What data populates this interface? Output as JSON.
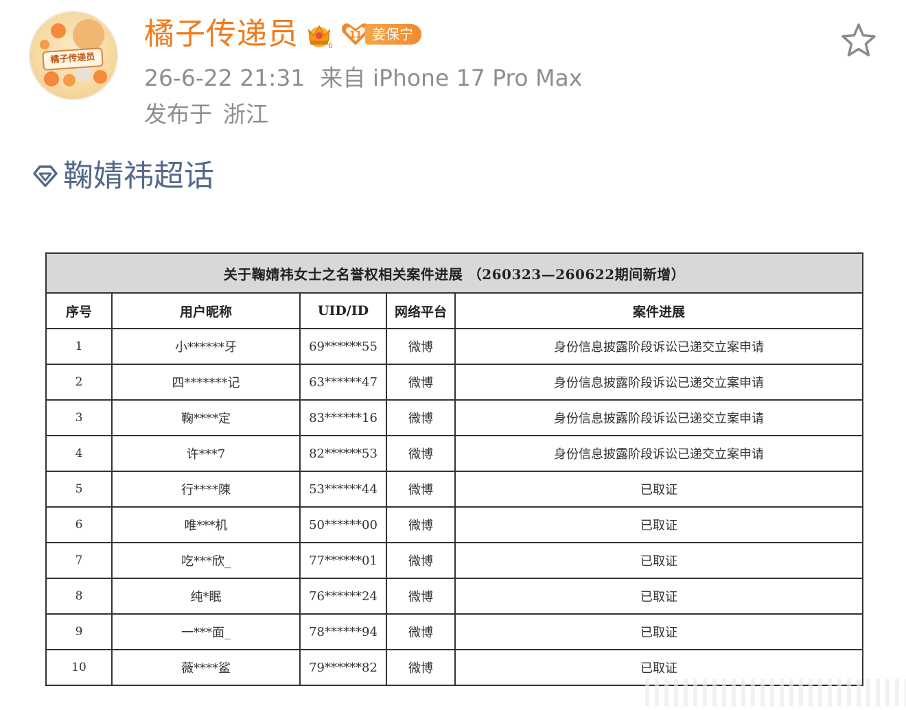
{
  "post": {
    "username": "橘子传递员",
    "avatar_text": "橘子传递员",
    "fan_badge": {
      "level": "11",
      "name": "姜保宁"
    },
    "timestamp": "26-6-22 21:31",
    "source": "来自 iPhone 17 Pro Max",
    "location_prefix": "发布于",
    "location": "浙江",
    "topic": "鞠婧祎超话",
    "icons": {
      "crown": "crown-vip-badge-icon",
      "fan": "heart-fan-badge-icon",
      "favorite": "star-outline-icon",
      "topic": "super-topic-diamond-icon"
    },
    "colors": {
      "username": "#f27a18",
      "meta": "#8e8e8e",
      "topic": "#55698a",
      "badge": "#f08a2f"
    }
  },
  "document": {
    "title": "关于鞠婧祎女士之名誉权相关案件进展 （260323—260622期间新增）",
    "columns": [
      "序号",
      "用户昵称",
      "UID/ID",
      "网络平台",
      "案件进展"
    ],
    "rows": [
      [
        "1",
        "小******牙",
        "69******55",
        "微博",
        "身份信息披露阶段诉讼已递交立案申请"
      ],
      [
        "2",
        "四*******记",
        "63******47",
        "微博",
        "身份信息披露阶段诉讼已递交立案申请"
      ],
      [
        "3",
        "鞠****定",
        "83******16",
        "微博",
        "身份信息披露阶段诉讼已递交立案申请"
      ],
      [
        "4",
        "许***7",
        "82******53",
        "微博",
        "身份信息披露阶段诉讼已递交立案申请"
      ],
      [
        "5",
        "行****陳",
        "53******44",
        "微博",
        "已取证"
      ],
      [
        "6",
        "唯***机",
        "50******00",
        "微博",
        "已取证"
      ],
      [
        "7",
        "吃***欣_",
        "77******01",
        "微博",
        "已取证"
      ],
      [
        "8",
        "纯*眠",
        "76******24",
        "微博",
        "已取证"
      ],
      [
        "9",
        "一***面_",
        "78******94",
        "微博",
        "已取证"
      ],
      [
        "10",
        "薇****鲨",
        "79******82",
        "微博",
        "已取证"
      ]
    ]
  }
}
